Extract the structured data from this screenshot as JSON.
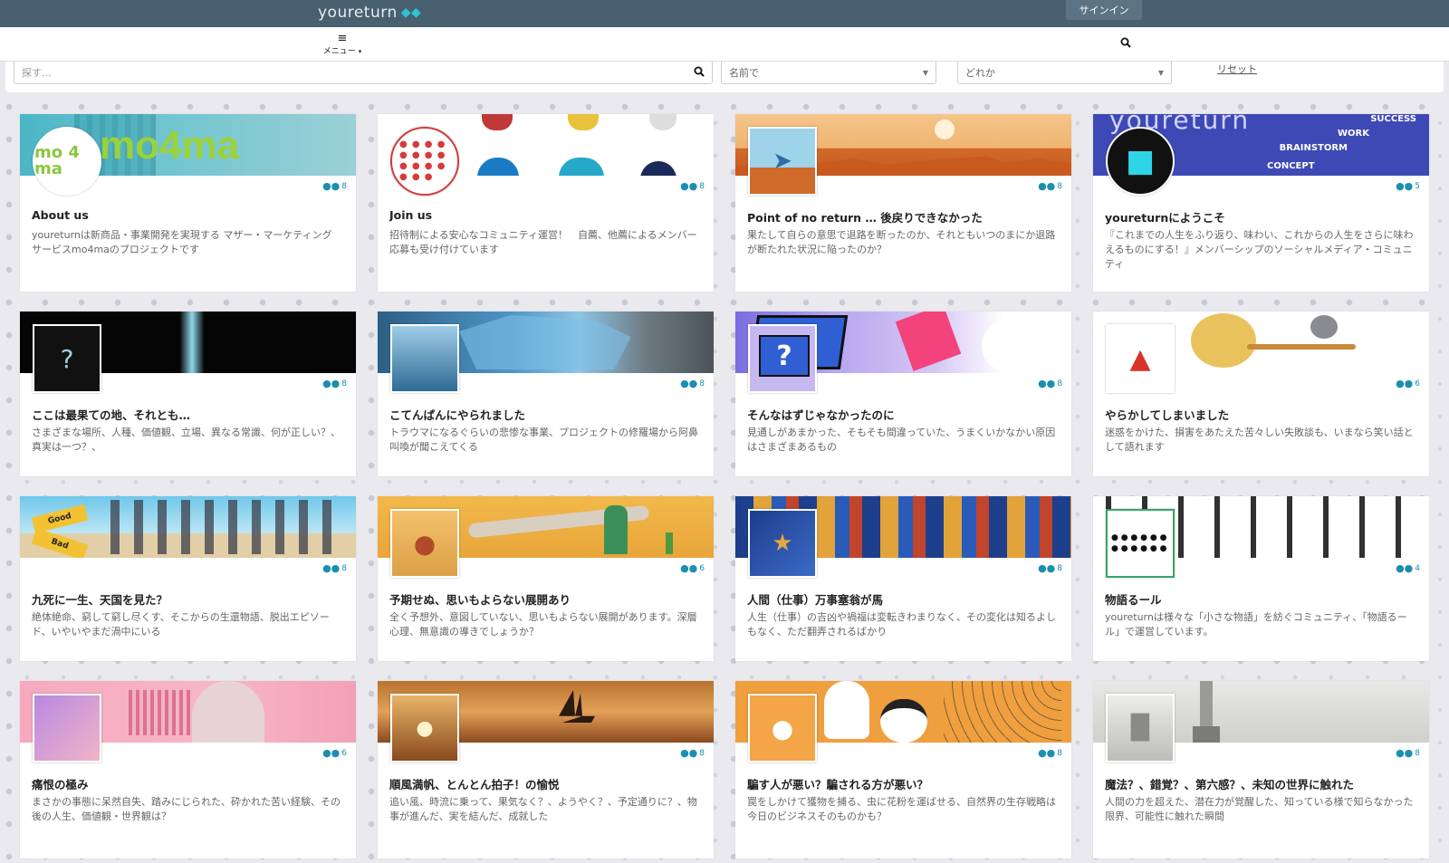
{
  "header": {
    "brand": "youreturn",
    "brand_icon": "space-invader-icon",
    "signin_label": "サインイン"
  },
  "menubar": {
    "menu_label": "メニュー",
    "search_icon": "search-icon"
  },
  "filters": {
    "search_placeholder": "探す...",
    "sort_value": "名前で",
    "category_value": "どれか",
    "reset_label": "リセット"
  },
  "colors": {
    "topbar": "#48606f",
    "accent": "#1a8fb0"
  },
  "cards": [
    {
      "title": "About us",
      "members": "8",
      "desc": "youreturnは新商品・事業開発を実現する マザー・マーケティング サービスmo4maのプロジェクトです"
    },
    {
      "title": "Join us",
      "members": "8",
      "desc": "招待制による安心なコミュニティ運営！　自薦、他薦によるメンバー応募も受け付けています"
    },
    {
      "title": "Point of no return … 後戻りできなかった",
      "members": "8",
      "desc": "果たして自らの意思で退路を断ったのか、それともいつのまにか退路が断たれた状況に陥ったのか？"
    },
    {
      "title": "youreturnにようこそ",
      "members": "5",
      "desc": "『これまでの人生をふり返り、味わい、これからの人生をさらに味わえるものにする！』メンバーシップのソーシャルメディア・コミュニティ"
    },
    {
      "title": "ここは最果ての地、それとも…",
      "members": "8",
      "desc": "さまざまな場所、人種、価値観、立場、異なる常識、何が正しい？、真実は一つ？、"
    },
    {
      "title": "こてんぱんにやられました",
      "members": "8",
      "desc": "トラウマになるぐらいの悲惨な事業、プロジェクトの修羅場から阿鼻叫喚が聞こえてくる"
    },
    {
      "title": "そんなはずじゃなかったのに",
      "members": "8",
      "desc": "見通しがあまかった、そもそも間違っていた、うまくいかなかい原因はさまざまあるもの"
    },
    {
      "title": "やらかしてしまいました",
      "members": "6",
      "desc": "迷惑をかけた、損害をあたえた苦々しい失敗談も、いまなら笑い話として語れます"
    },
    {
      "title": "九死に一生、天国を見た？",
      "members": "8",
      "desc": "絶体絶命、窮して窮し尽くす、そこからの生還物語、脱出エピソード、いやいやまだ渦中にいる"
    },
    {
      "title": "予期せぬ、思いもよらない展開あり",
      "members": "6",
      "desc": "全く予想外、意図していない、思いもよらない展開があります。深層心理、無意識の導きでしょうか？"
    },
    {
      "title": "人間（仕事）万事塞翁が馬",
      "members": "8",
      "desc": "人生（仕事）の吉凶や禍福は変転きわまりなく、その変化は知るよしもなく、ただ翻弄されるばかり"
    },
    {
      "title": "物語るール",
      "members": "4",
      "desc": "youreturnは様々な「小さな物語」を紡ぐコミュニティ、「物語るール」で運営しています。"
    },
    {
      "title": "痛恨の極み",
      "members": "6",
      "desc": "まさかの事態に呆然自失、踏みにじられた、砕かれた苦い経験、その後の人生、価値観・世界観は？"
    },
    {
      "title": "順風満帆、とんとん拍子！の愉悦",
      "members": "8",
      "desc": "追い風、時流に乗って、果気なく？、ようやく？、予定通りに？、物事が進んだ、実を結んだ、成就した"
    },
    {
      "title": "騙す人が悪い？騙される方が悪い？",
      "members": "8",
      "desc": "罠をしかけて獲物を捕る、虫に花粉を運ばせる、自然界の生存戦略は今日のビジネスそのものかも？"
    },
    {
      "title": "魔法？、錯覚？、第六感？、未知の世界に触れた",
      "members": "8",
      "desc": "人間の力を超えた、潜在力が覚醒した、知っている様で知らなかった限界、可能性に触れた瞬間"
    }
  ],
  "banner_text": {
    "mo4ma": "mo4ma",
    "thumb_mo4ma": "mo 4 ma",
    "youreturn_banner": "youreturn",
    "success": "SUCCESS",
    "work": "WORK",
    "brainstorm": "BRAINSTORM",
    "concept": "CONCEPT",
    "good": "Good",
    "bad": "Bad"
  }
}
